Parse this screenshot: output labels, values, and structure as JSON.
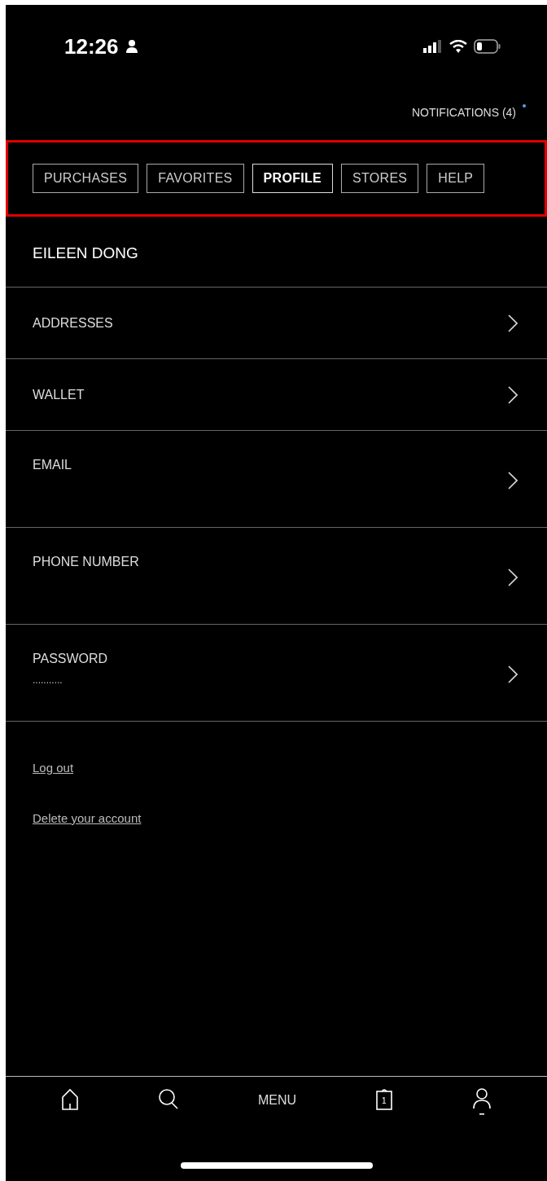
{
  "status_bar": {
    "time": "12:26"
  },
  "notifications": {
    "label": "NOTIFICATIONS (4)",
    "unread": true
  },
  "tabs": [
    {
      "label": "PURCHASES",
      "selected": false
    },
    {
      "label": "FAVORITES",
      "selected": false
    },
    {
      "label": "PROFILE",
      "selected": true
    },
    {
      "label": "STORES",
      "selected": false
    },
    {
      "label": "HELP",
      "selected": false
    }
  ],
  "highlighted": true,
  "profile_name": "EILEEN DONG",
  "rows": [
    {
      "label": "ADDRESSES",
      "tall": false
    },
    {
      "label": "WALLET",
      "tall": false
    },
    {
      "label": "EMAIL",
      "tall": true
    },
    {
      "label": "PHONE NUMBER",
      "tall": true
    },
    {
      "label": "PASSWORD",
      "tall": true,
      "value": "..........."
    }
  ],
  "links": [
    "Log out",
    "Delete your account"
  ],
  "bottom_nav": [
    {
      "kind": "home",
      "selected": false
    },
    {
      "kind": "search",
      "selected": false
    },
    {
      "kind": "menu",
      "label": "MENU",
      "selected": false
    },
    {
      "kind": "bag",
      "badge": "1",
      "selected": false
    },
    {
      "kind": "account",
      "selected": true
    }
  ]
}
